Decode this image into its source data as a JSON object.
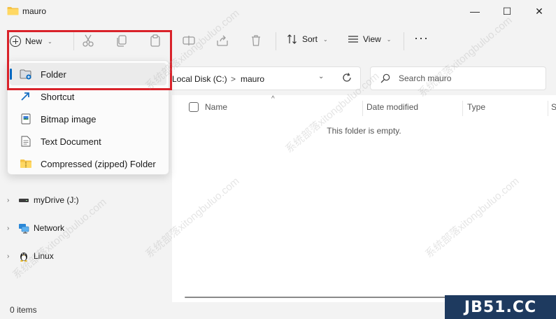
{
  "window": {
    "title": "mauro",
    "minimize_glyph": "—",
    "maximize_glyph": "☐",
    "close_glyph": "✕"
  },
  "toolbar": {
    "new_label": "New",
    "sort_label": "Sort",
    "view_label": "View",
    "more_glyph": "···",
    "chevron": "⌄"
  },
  "new_menu": {
    "items": [
      {
        "label": "Folder",
        "icon": "new-folder-icon"
      },
      {
        "label": "Shortcut",
        "icon": "shortcut-icon"
      },
      {
        "label": "Bitmap image",
        "icon": "bitmap-icon"
      },
      {
        "label": "Text Document",
        "icon": "text-document-icon"
      },
      {
        "label": "Compressed (zipped) Folder",
        "icon": "zip-folder-icon"
      }
    ]
  },
  "address": {
    "crumbs": [
      "Local Disk (C:)",
      "mauro"
    ],
    "separator": ">",
    "dropdown_glyph": "⌄"
  },
  "search": {
    "placeholder": "Search mauro"
  },
  "content": {
    "columns": [
      "Name",
      "Date modified",
      "Type",
      "S"
    ],
    "sort_caret": "^",
    "empty_message": "This folder is empty."
  },
  "nav": {
    "items": [
      {
        "label": "myDrive (J:)",
        "icon": "drive-icon"
      },
      {
        "label": "Network",
        "icon": "network-icon"
      },
      {
        "label": "Linux",
        "icon": "linux-icon"
      }
    ],
    "expand_glyph": "›"
  },
  "status": {
    "items_count": "0 items"
  },
  "watermark": {
    "brand": "JB51.CC",
    "faint_text": "系统部落xitongbuluo.com"
  },
  "colors": {
    "highlight": "#d9222a",
    "accent": "#0067c0",
    "folder": "#f5c245"
  }
}
